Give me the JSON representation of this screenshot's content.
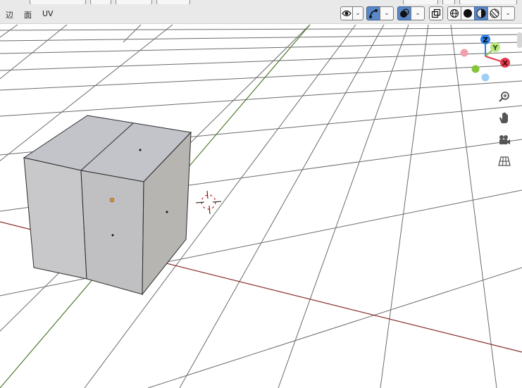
{
  "header": {
    "menus": [
      {
        "label": "辺"
      },
      {
        "label": "面"
      },
      {
        "label": "UV"
      }
    ]
  },
  "gizmo": {
    "axes": [
      {
        "label": "Z",
        "color": "#2d7fe6"
      },
      {
        "label": "Y",
        "color": "#86c04a"
      },
      {
        "label": "X",
        "color": "#e23b4b"
      }
    ]
  },
  "colors": {
    "x_axis_line": "#8b2e2e",
    "y_axis_line": "#4f7a2e",
    "grid": "#6a6a6a",
    "active_button": "#5a87c7",
    "selected_vertex": "#f2a33a"
  },
  "icons": {
    "visibility": "eye-icon",
    "gizmo_toggle": "gizmo-icon",
    "overlay_toggle": "overlay-icon",
    "xray": "xray-icon",
    "wireframe": "wireframe-shading-icon",
    "solid": "solid-shading-icon",
    "material": "material-shading-icon",
    "rendered": "rendered-shading-icon",
    "zoom": "zoom-icon",
    "pan": "hand-icon",
    "camera": "camera-icon",
    "perspective": "grid-perspective-icon"
  }
}
